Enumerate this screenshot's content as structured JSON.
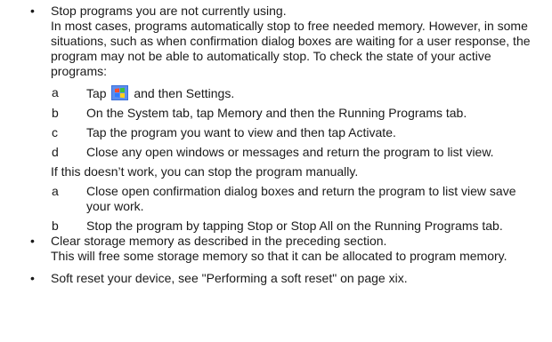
{
  "bullet_mark": "•",
  "bullets": [
    {
      "lead": "Stop programs you are not currently using.",
      "body": "In most cases, programs automatically stop to free needed memory. However, in some situations, such as when confirmation dialog boxes are waiting for a user response, the program may not be able to automatically stop. To check the state of your active programs:",
      "steps1": [
        {
          "letter": "a",
          "before_icon": "Tap",
          "icon": "windows-start-icon",
          "after_icon": "and then Settings."
        },
        {
          "letter": "b",
          "text": "On the System tab, tap Memory and then the Running Programs tab."
        },
        {
          "letter": "c",
          "text": "Tap the program you want to view and then tap Activate."
        },
        {
          "letter": "d",
          "text": "Close any open windows or messages and return the program to list view."
        }
      ],
      "fallback": "If this doesn’t work, you can stop the program manually.",
      "steps2": [
        {
          "letter": "a",
          "text": "Close open confirmation dialog boxes and return the program to list view save your work."
        },
        {
          "letter": "b",
          "text": "Stop the program by tapping Stop or Stop All on the Running Programs tab."
        }
      ]
    },
    {
      "lead": "Clear storage memory as described in the preceding section.",
      "body": "This will free some storage memory so that it can be allocated to program memory."
    },
    {
      "lead": "Soft reset your device, see \"Performing a soft reset\" on page xix."
    }
  ]
}
